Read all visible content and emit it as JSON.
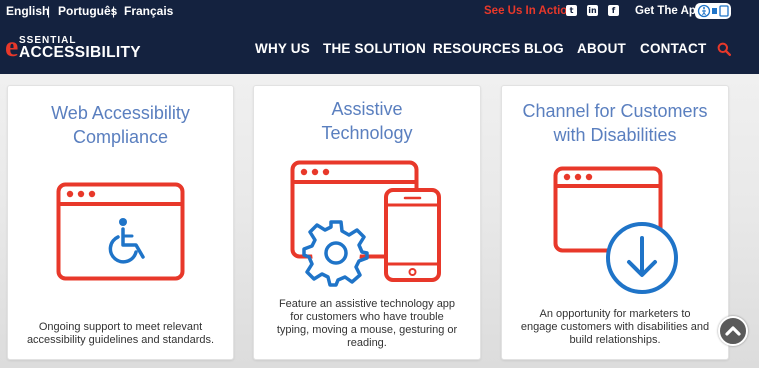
{
  "topbar": {
    "languages": [
      "English",
      "Português",
      "Français"
    ],
    "separator": "|",
    "see_us": "See Us In Action",
    "social_icons": [
      "twitter-icon",
      "linkedin-icon",
      "facebook-icon"
    ],
    "get_app": "Get The App"
  },
  "logo": {
    "letter": "e",
    "top": "SSENTIAL",
    "bottom": "ACCESSIBILITY"
  },
  "nav": {
    "items": [
      "WHY US",
      "THE SOLUTION",
      "RESOURCES",
      "BLOG",
      "ABOUT",
      "CONTACT"
    ]
  },
  "cards": [
    {
      "title_line1": "Web Accessibility",
      "title_line2": "Compliance",
      "desc_line1": "Ongoing support to meet relevant",
      "desc_line2": "accessibility guidelines and standards.",
      "icon": "browser-wheelchair-icon"
    },
    {
      "title_line1": "Assistive",
      "title_line2": "Technology",
      "desc_line1": "Feature an assistive technology app",
      "desc_line2": "for customers who have trouble",
      "desc_line3": "typing, moving a mouse, gesturing or",
      "desc_line4": "reading.",
      "icon": "browser-phone-gear-icon"
    },
    {
      "title_line1": "Channel for Customers",
      "title_line2": "with Disabilities",
      "desc_line1": "An opportunity for marketers to",
      "desc_line2": "engage customers with disabilities and",
      "desc_line3": "build relationships.",
      "icon": "browser-download-icon"
    }
  ],
  "colors": {
    "navy": "#14223f",
    "red": "#e8382a",
    "blue": "#1f74c8",
    "title_blue": "#5a7fbf"
  }
}
